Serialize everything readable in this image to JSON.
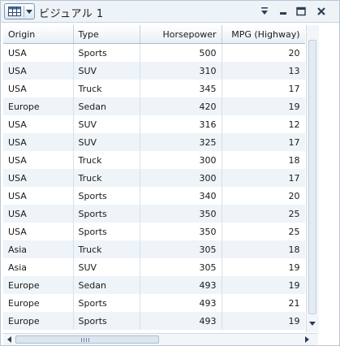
{
  "window": {
    "title": "ビジュアル 1",
    "icons": {
      "visual_type": "table-icon",
      "menu": "chevron-down-icon",
      "options": "options-menu-icon",
      "minimize": "minimize-icon",
      "maximize": "maximize-icon",
      "close": "close-icon"
    }
  },
  "table": {
    "columns": [
      "Origin",
      "Type",
      "Horsepower",
      "MPG (Highway)"
    ],
    "rows": [
      [
        "USA",
        "Sports",
        "500",
        "20"
      ],
      [
        "USA",
        "SUV",
        "310",
        "13"
      ],
      [
        "USA",
        "Truck",
        "345",
        "17"
      ],
      [
        "Europe",
        "Sedan",
        "420",
        "19"
      ],
      [
        "USA",
        "SUV",
        "316",
        "12"
      ],
      [
        "USA",
        "SUV",
        "325",
        "17"
      ],
      [
        "USA",
        "Truck",
        "300",
        "18"
      ],
      [
        "USA",
        "Truck",
        "300",
        "17"
      ],
      [
        "USA",
        "Sports",
        "340",
        "20"
      ],
      [
        "USA",
        "Sports",
        "350",
        "25"
      ],
      [
        "USA",
        "Sports",
        "350",
        "25"
      ],
      [
        "Asia",
        "Truck",
        "305",
        "18"
      ],
      [
        "Asia",
        "SUV",
        "305",
        "19"
      ],
      [
        "Europe",
        "Sedan",
        "493",
        "19"
      ],
      [
        "Europe",
        "Sports",
        "493",
        "21"
      ],
      [
        "Europe",
        "Sports",
        "493",
        "19"
      ]
    ]
  },
  "colors": {
    "header_bg": "#e9eff5",
    "stripe": "#eef4f8",
    "border": "#b7c6d6"
  }
}
